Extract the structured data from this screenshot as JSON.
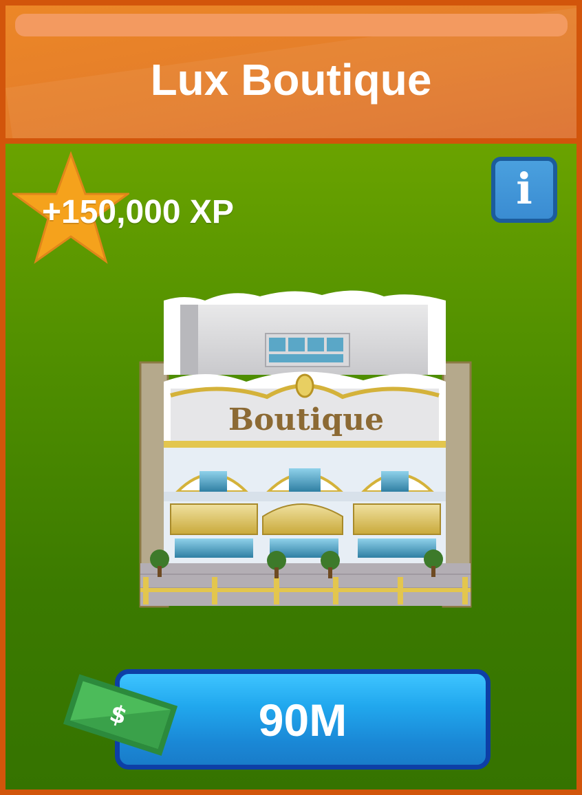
{
  "header": {
    "title": "Lux Boutique"
  },
  "reward": {
    "xp_text": "+150,000 XP"
  },
  "info_button": {
    "glyph": "i"
  },
  "item": {
    "sign_text": "Boutique"
  },
  "purchase": {
    "price": "90M",
    "currency_symbol": "$"
  },
  "colors": {
    "header_orange": "#e37c2b",
    "frame_orange": "#d2550b",
    "body_green": "#4f8e00",
    "star_gold": "#f5a21c",
    "button_blue": "#21a8ee",
    "button_border": "#0d3fa6",
    "info_blue": "#3a8cd2",
    "money_green": "#3aa14a"
  }
}
